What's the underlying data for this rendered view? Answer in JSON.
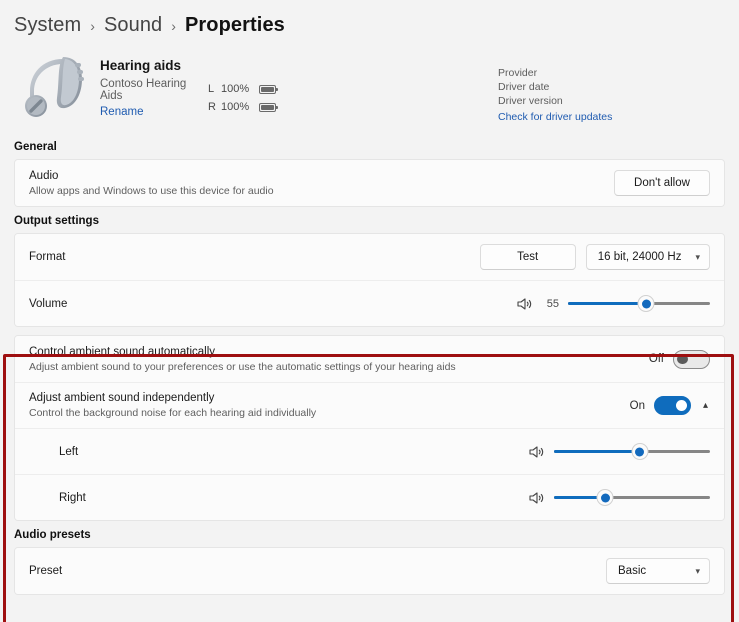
{
  "breadcrumb": {
    "items": [
      "System",
      "Sound"
    ],
    "current": "Properties",
    "separator": "›"
  },
  "device": {
    "icon": "hearing-aid-icon",
    "name": "Hearing aids",
    "model": "Contoso Hearing Aids",
    "rename_label": "Rename",
    "battery": [
      {
        "channel": "L",
        "percent": "100%"
      },
      {
        "channel": "R",
        "percent": "100%"
      }
    ]
  },
  "driver": {
    "provider_label": "Provider",
    "date_label": "Driver date",
    "version_label": "Driver version",
    "check_updates_label": "Check for driver updates"
  },
  "sections": {
    "general": {
      "heading": "General",
      "audio": {
        "title": "Audio",
        "description": "Allow apps and Windows to use this device for audio",
        "button_label": "Don't allow"
      }
    },
    "output_settings": {
      "heading": "Output settings",
      "format": {
        "title": "Format",
        "test_label": "Test",
        "selected": "16 bit, 24000 Hz"
      },
      "volume": {
        "title": "Volume",
        "icon": "speaker-icon",
        "value": "55",
        "percent": 55
      }
    },
    "ambient": {
      "auto": {
        "title": "Control ambient sound automatically",
        "description": "Adjust ambient sound to your preferences or use the automatic settings of your hearing aids",
        "toggle_label": "Off",
        "toggle_on": false
      },
      "independent": {
        "title": "Adjust ambient sound independently",
        "description": "Control the background noise for each hearing aid individually",
        "toggle_label": "On",
        "toggle_on": true,
        "expander_icon": "chevron-up-icon",
        "channels": [
          {
            "label": "Left",
            "icon": "speaker-icon",
            "percent": 55
          },
          {
            "label": "Right",
            "icon": "speaker-icon",
            "percent": 33
          }
        ]
      }
    },
    "audio_presets": {
      "heading": "Audio presets",
      "preset": {
        "title": "Preset",
        "selected": "Basic"
      }
    }
  },
  "colors": {
    "accent": "#0f6cbd",
    "link": "#1f5bb0",
    "highlight_border": "#9e0f10",
    "page_background": "#f3f3f3"
  }
}
